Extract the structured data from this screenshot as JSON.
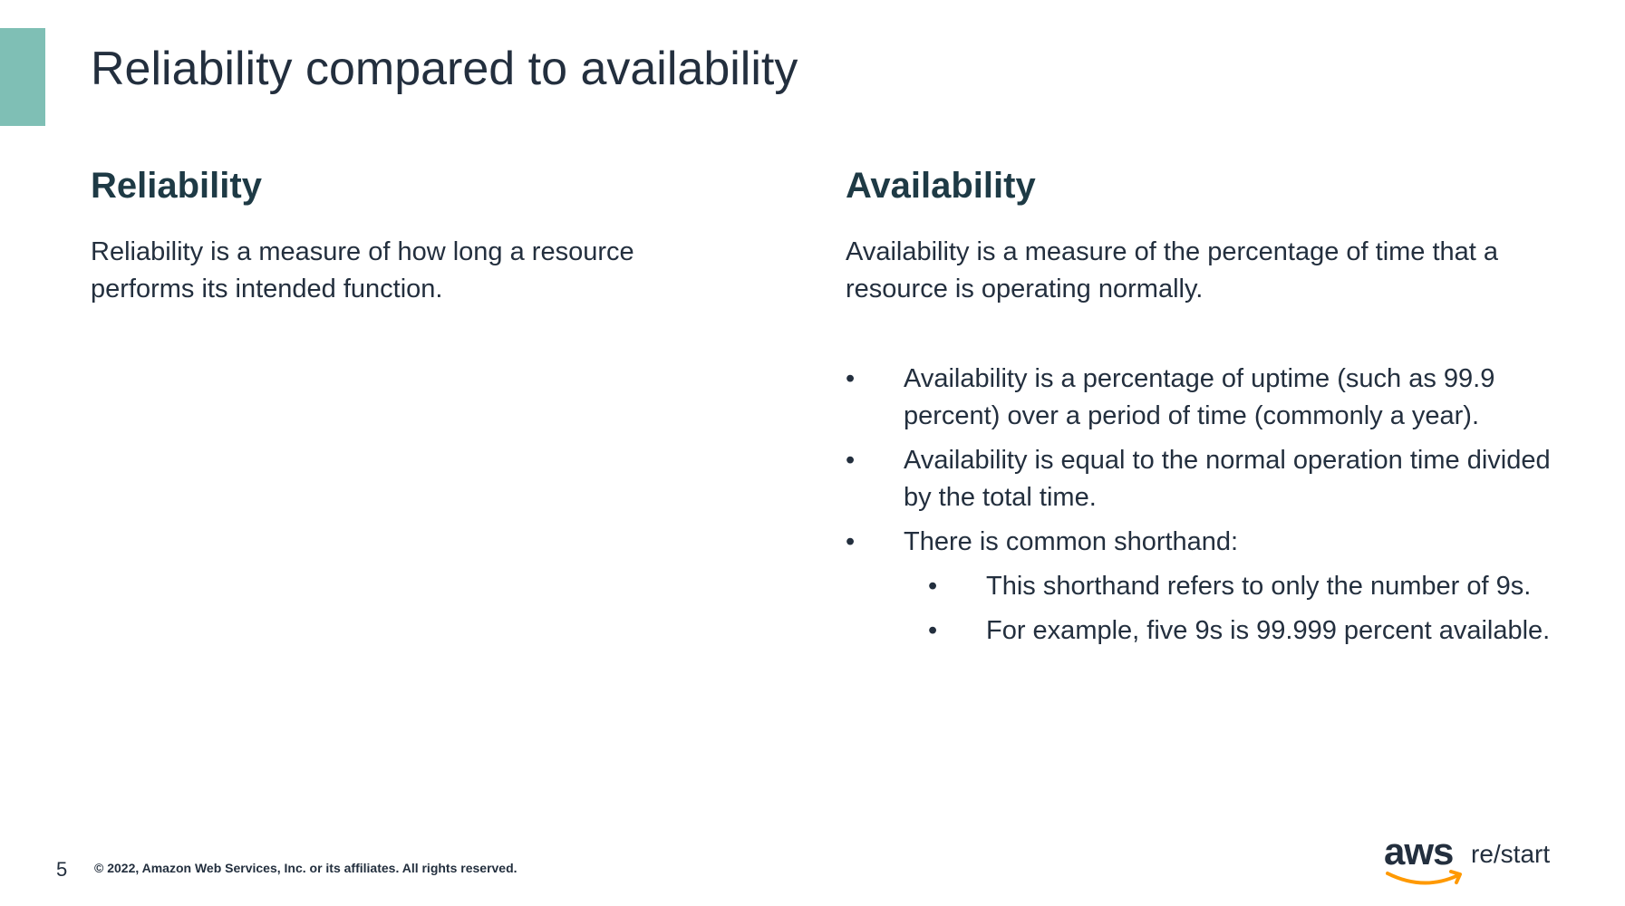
{
  "slide": {
    "title": "Reliability compared to availability"
  },
  "left": {
    "heading": "Reliability",
    "text": "Reliability is a measure of how long a resource performs its intended function."
  },
  "right": {
    "heading": "Availability",
    "text": "Availability is a measure of the percentage of time that a resource is operating normally.",
    "bullets": [
      {
        "mark": "•",
        "text": "Availability is a percentage of uptime (such as 99.9 percent) over a period of time (commonly a year)."
      },
      {
        "mark": "•",
        "text": "Availability is equal to the normal operation time divided by the total time."
      },
      {
        "mark": "•",
        "text": "There is common shorthand:"
      }
    ],
    "sub_bullets": [
      {
        "mark": "•",
        "text": "This shorthand refers to only the number of 9s."
      },
      {
        "mark": "•",
        "text": "For example, five 9s is 99.999 percent available."
      }
    ]
  },
  "footer": {
    "page_number": "5",
    "copyright": "© 2022, Amazon Web Services, Inc. or its affiliates. All rights reserved.",
    "logo_aws": "aws",
    "logo_restart": "re/start"
  },
  "colors": {
    "accent": "#7fbfb5",
    "heading": "#1e3a45",
    "text": "#232f3e",
    "smile": "#ff9900"
  }
}
